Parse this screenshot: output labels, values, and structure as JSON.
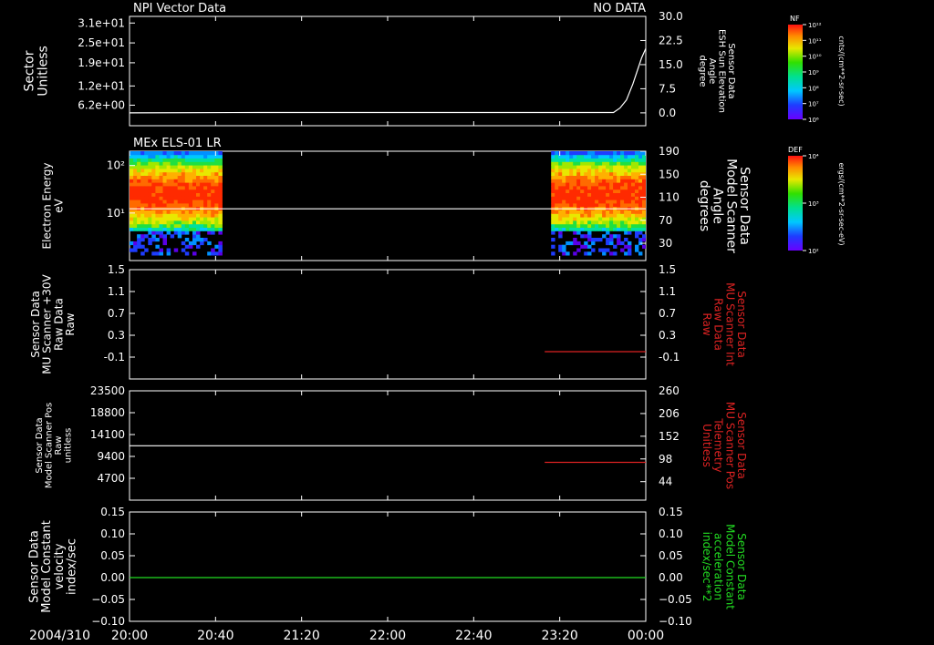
{
  "colors": {
    "background": "#000000",
    "foreground": "#ffffff",
    "red_series": "#dd2222",
    "green_series": "#22dd22"
  },
  "time_axis": {
    "date_label": "2004/310",
    "ticks": [
      "20:00",
      "20:40",
      "21:20",
      "22:00",
      "22:40",
      "23:20",
      "00:00"
    ],
    "range_minutes": [
      0,
      240
    ]
  },
  "colorbars": [
    {
      "top_label": "NF",
      "ticks": [
        "10¹²",
        "10¹¹",
        "10¹⁰",
        "10⁹",
        "10⁸",
        "10⁷",
        "10⁶"
      ],
      "unit_label": "cnts/(cm**2-sr-sec)"
    },
    {
      "top_label": "DEF",
      "ticks": [
        "10⁴",
        "10³",
        "10²"
      ],
      "unit_label": "ergs/(cm**2-sr-sec-eV)"
    }
  ],
  "chart_data": [
    {
      "type": "line",
      "panel_title": "NPI Vector Data",
      "status_label": "NO DATA",
      "ylabel_left": [
        "Sector",
        "Unitless"
      ],
      "yticks_left": [
        "3.1e+01",
        "2.5e+01",
        "1.9e+01",
        "1.2e+01",
        "6.2e+00"
      ],
      "yticks_left_values": [
        31,
        25,
        19,
        12,
        6.2
      ],
      "ylim_left": [
        0,
        33
      ],
      "ylabel_right": [
        "Sensor Data",
        "ESH Sun Elevation",
        "Angle",
        "degree"
      ],
      "yticks_right": [
        "30.0",
        "22.5",
        "15.0",
        "7.5",
        "0.0"
      ],
      "yticks_right_values": [
        30,
        22.5,
        15,
        7.5,
        0
      ],
      "ylim_right": [
        -4,
        30
      ],
      "series": [
        {
          "axis": "right",
          "color": "#ffffff",
          "x_minutes": [
            0,
            60,
            120,
            180,
            225,
            228,
            231,
            234,
            236,
            238,
            240
          ],
          "values": [
            0,
            0.1,
            0.1,
            0.1,
            0.1,
            1.5,
            4,
            9,
            13,
            17,
            20
          ]
        }
      ]
    },
    {
      "type": "heatmap",
      "panel_title": "MEx ELS-01 LR",
      "ylabel_left": [
        "Electron Energy",
        "eV"
      ],
      "yticks_left": [
        "10²",
        "10¹"
      ],
      "yticks_left_values": [
        100,
        10
      ],
      "ylim_left_log": [
        1,
        200
      ],
      "ylabel_right": [
        "Sensor Data",
        "Model Scanner",
        "Angle",
        "degrees"
      ],
      "yticks_right": [
        "190",
        "150",
        "110",
        "70",
        "30"
      ],
      "yticks_right_values": [
        190,
        150,
        110,
        70,
        30
      ],
      "ylim_right": [
        0,
        190
      ],
      "data_intervals_minutes": [
        [
          0,
          43
        ],
        [
          196,
          240
        ]
      ],
      "energy_range_eV": [
        1.3,
        200
      ],
      "peak_energy_eV": 25,
      "series": [
        {
          "axis": "right",
          "color": "#ffffff",
          "x_minutes": [
            0,
            240
          ],
          "values": [
            90,
            90
          ]
        }
      ]
    },
    {
      "type": "line",
      "ylabel_left": [
        "Sensor Data",
        "MU Scanner +30V",
        "Raw Data",
        "Raw"
      ],
      "yticks_left": [
        "1.5",
        "1.1",
        "0.7",
        "0.3",
        "-0.1"
      ],
      "yticks_left_values": [
        1.5,
        1.1,
        0.7,
        0.3,
        -0.1
      ],
      "ylim_left": [
        -0.5,
        1.5
      ],
      "ylabel_right": [
        "Sensor Data",
        "MU Scanner Int",
        "Raw Data",
        "Raw"
      ],
      "yticks_right": [
        "1.5",
        "1.1",
        "0.7",
        "0.3",
        "-0.1"
      ],
      "yticks_right_values": [
        1.5,
        1.1,
        0.7,
        0.3,
        -0.1
      ],
      "ylim_right": [
        -0.5,
        1.5
      ],
      "series": [
        {
          "axis": "right",
          "color": "#dd2222",
          "x_minutes": [
            193,
            240
          ],
          "values": [
            0,
            0
          ]
        }
      ]
    },
    {
      "type": "line",
      "ylabel_left": [
        "Sensor Data",
        "Model Scanner Pos",
        "Raw",
        "unitless"
      ],
      "yticks_left": [
        "23500",
        "18800",
        "14100",
        "9400",
        "4700"
      ],
      "yticks_left_values": [
        23500,
        18800,
        14100,
        9400,
        4700
      ],
      "ylim_left": [
        0,
        23500
      ],
      "ylabel_right": [
        "Sensor Data",
        "MU Scanner Pos",
        "Telemetry",
        "Unitless"
      ],
      "yticks_right": [
        "260",
        "206",
        "152",
        "98",
        "44"
      ],
      "yticks_right_values": [
        260,
        206,
        152,
        98,
        44
      ],
      "ylim_right": [
        0,
        260
      ],
      "series": [
        {
          "axis": "left",
          "color": "#ffffff",
          "x_minutes": [
            0,
            240
          ],
          "values": [
            11700,
            11700
          ]
        },
        {
          "axis": "right",
          "color": "#dd2222",
          "x_minutes": [
            193,
            240
          ],
          "values": [
            90,
            90
          ]
        }
      ]
    },
    {
      "type": "line",
      "ylabel_left": [
        "Sensor Data",
        "Model Constant",
        "velocity",
        "index/sec"
      ],
      "yticks_left": [
        "0.15",
        "0.10",
        "0.05",
        "0.00",
        "−0.05",
        "−0.10"
      ],
      "yticks_left_values": [
        0.15,
        0.1,
        0.05,
        0,
        -0.05,
        -0.1
      ],
      "ylim_left": [
        -0.1,
        0.15
      ],
      "ylabel_right": [
        "Sensor Data",
        "Model Constant",
        "acceleration",
        "index/sec**2"
      ],
      "yticks_right": [
        "0.15",
        "0.10",
        "0.05",
        "0.00",
        "−0.05",
        "−0.10"
      ],
      "yticks_right_values": [
        0.15,
        0.1,
        0.05,
        0,
        -0.05,
        -0.1
      ],
      "ylim_right": [
        -0.1,
        0.15
      ],
      "series": [
        {
          "axis": "left",
          "color": "#22dd22",
          "x_minutes": [
            0,
            240
          ],
          "values": [
            0,
            0
          ]
        }
      ]
    }
  ]
}
